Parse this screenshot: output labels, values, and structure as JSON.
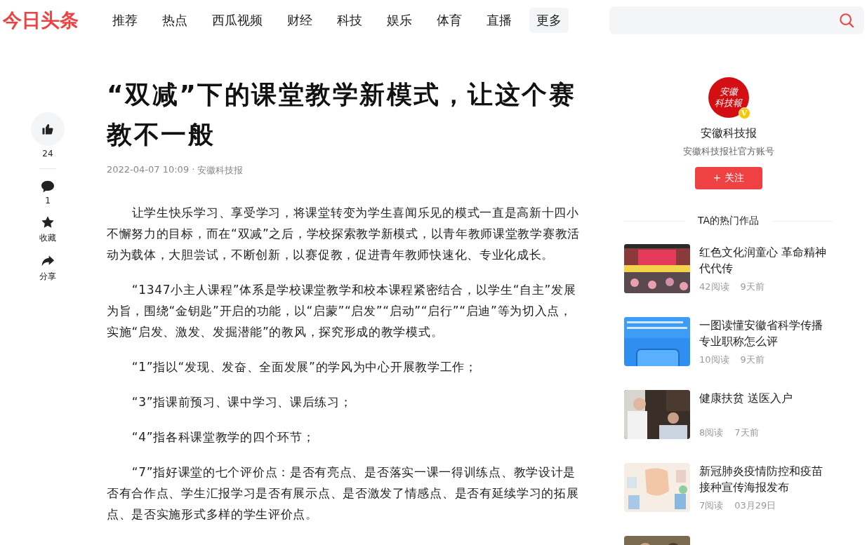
{
  "header": {
    "logo": "今日头条",
    "nav": [
      {
        "label": "推荐",
        "kind": "link"
      },
      {
        "label": "热点",
        "kind": "link"
      },
      {
        "label": "西瓜视频",
        "kind": "link"
      },
      {
        "label": "财经",
        "kind": "link"
      },
      {
        "label": "科技",
        "kind": "link"
      },
      {
        "label": "娱乐",
        "kind": "link"
      },
      {
        "label": "体育",
        "kind": "link"
      },
      {
        "label": "直播",
        "kind": "link"
      },
      {
        "label": "更多",
        "kind": "more"
      }
    ]
  },
  "actions": [
    {
      "kind": "like",
      "label": "24"
    },
    {
      "kind": "comment",
      "label": "1"
    },
    {
      "kind": "star",
      "label": "收藏"
    },
    {
      "kind": "share",
      "label": "分享"
    }
  ],
  "article": {
    "title": "“双减”下的课堂教学新模式，让这个赛教不一般",
    "date": "2022-04-07 10:09",
    "separator": "·",
    "source": "安徽科技报",
    "paragraphs": [
      "让学生快乐学习、享受学习，将课堂转变为学生喜闻乐见的模式一直是高新十四小不懈努力的目标，而在“双减”之后，学校探索教学新模式，以青年教师课堂教学赛教活动为载体，大胆尝试，不断创新，以赛促教，促进青年教师快速化、专业化成长。",
      "“1347小主人课程”体系是学校课堂教学和校本课程紧密结合，以学生“自主”发展为旨，围绕“金钥匙”开启的功能，以“启蒙”“启发”“启动”“启行”“启迪”等为切入点，实施“启发、激发、发掘潜能”的教风，探究形成的教学模式。",
      "“1”指以“发现、发奋、全面发展”的学风为中心开展教学工作；",
      "“3”指课前预习、课中学习、课后练习；",
      "“4”指各科课堂教学的四个环节；",
      "“7”指好课堂的七个评价点：是否有亮点、是否落实一课一得训练点、教学设计是否有合作点、学生汇报学习是否有展示点、是否激发了情感点、是否有延续学习的拓展点、是否实施形式多样的学生评价点。"
    ]
  },
  "author": {
    "logo_text": [
      "安徽",
      "科技報"
    ],
    "verified_mark": "V",
    "name": "安徽科技报",
    "description": "安徽科技报社官方账号",
    "follow_button": "+ 关注",
    "hot_heading": "TA的热门作品",
    "hot_items": [
      {
        "kind": "article",
        "title": "红色文化润童心 革命精神代代传",
        "reads": "42阅读",
        "time": "9天前"
      },
      {
        "kind": "article",
        "title": "一图读懂安徽省科学传播专业职称怎么评",
        "reads": "10阅读",
        "time": "9天前"
      },
      {
        "kind": "article",
        "title": "健康扶贫 送医入户",
        "reads": "8阅读",
        "time": "7天前"
      },
      {
        "kind": "article",
        "title": "新冠肺炎疫情防控和疫苗接种宣传海报发布",
        "reads": "7阅读",
        "time": "03月29日"
      },
      {
        "kind": "picture"
      }
    ]
  }
}
